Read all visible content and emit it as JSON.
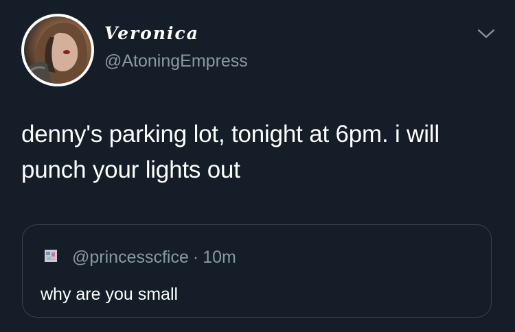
{
  "tweet": {
    "display_name": "Veronica",
    "handle": "@AtoningEmpress",
    "text": "denny's parking lot, tonight at 6pm. i will punch your lights out"
  },
  "quoted_tweet": {
    "handle": "@princesscfice",
    "separator": "·",
    "time": "10m",
    "text": "why are you small"
  },
  "icons": {
    "menu": "chevron-down-icon"
  },
  "colors": {
    "background": "#151d28",
    "secondary_text": "#8899a6",
    "border": "#38444d"
  }
}
